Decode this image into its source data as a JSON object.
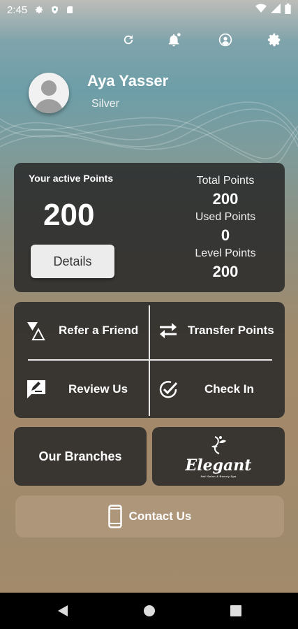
{
  "status_bar": {
    "time": "2:45",
    "left_icons": [
      "gear-icon",
      "shield-icon",
      "sd-card-icon"
    ],
    "right_icons": [
      "wifi-icon",
      "signal-icon",
      "battery-icon"
    ]
  },
  "top_actions": [
    "refresh-icon",
    "notification-bell-icon",
    "account-icon",
    "settings-icon"
  ],
  "profile": {
    "name": "Aya Yasser",
    "level": "Silver"
  },
  "points_card": {
    "title": "Your active Points",
    "active_points": "200",
    "details_label": "Details",
    "stats": [
      {
        "label": "Total Points",
        "value": "200"
      },
      {
        "label": "Used Points",
        "value": "0"
      },
      {
        "label": "Level Points",
        "value": "200"
      }
    ]
  },
  "actions": {
    "refer": "Refer a Friend",
    "transfer": "Transfer Points",
    "review": "Review Us",
    "checkin": "Check In"
  },
  "branches_label": "Our Branches",
  "brand_logo": {
    "name": "Elegant",
    "tagline": "Nail Salon & Beauty Spa"
  },
  "contact_label": "Contact Us",
  "colors": {
    "card_bg": "#282828",
    "accent_text": "#ffffff",
    "button_bg": "#ececec"
  }
}
